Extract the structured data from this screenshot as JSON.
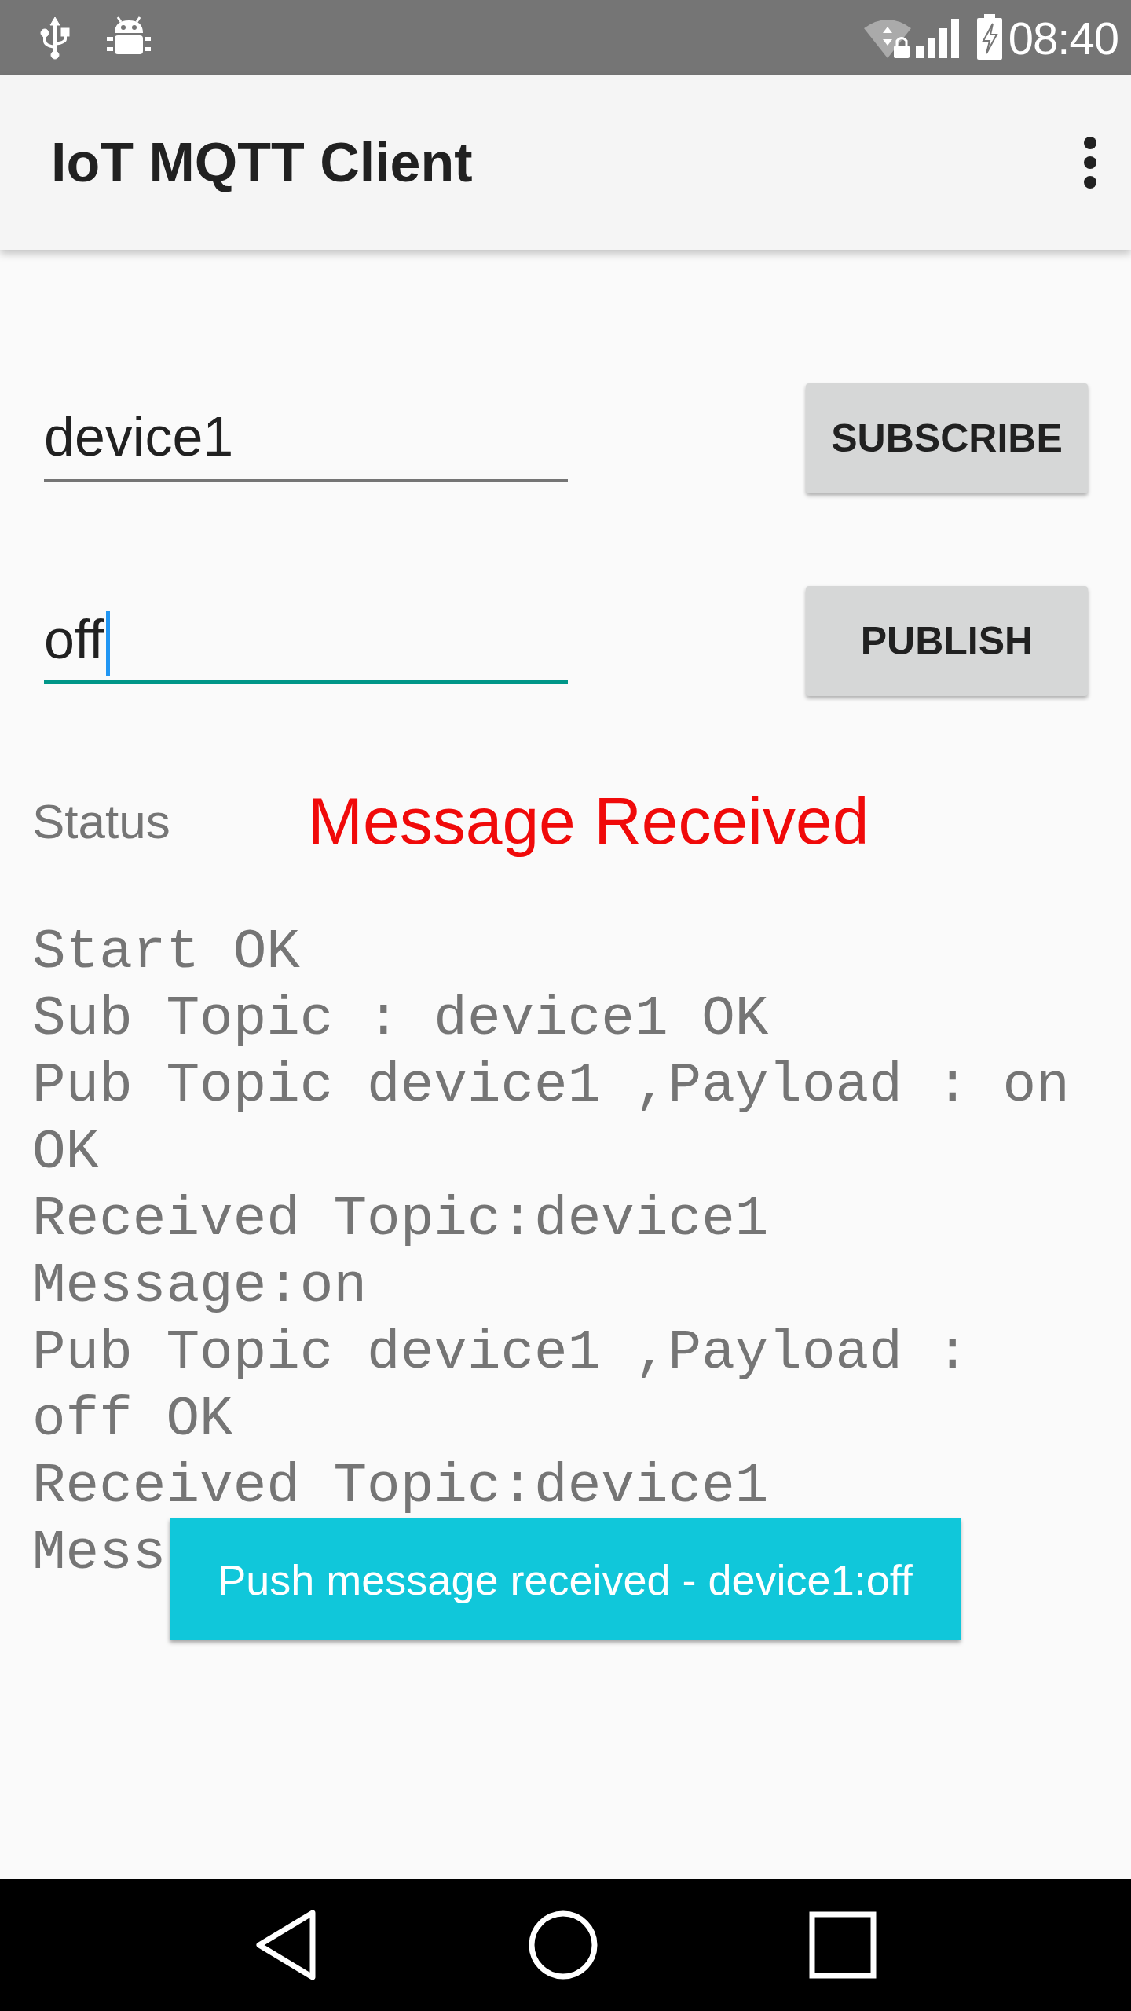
{
  "status_bar": {
    "time": "08:40"
  },
  "app_bar": {
    "title": "IoT MQTT Client"
  },
  "topic_rows": [
    {
      "field": {
        "value": "device1",
        "focused": false
      },
      "button": "SUBSCRIBE"
    },
    {
      "field": {
        "value": "off",
        "focused": true
      },
      "button": "PUBLISH"
    }
  ],
  "status": {
    "label": "Status",
    "message": "Message Received"
  },
  "log": [
    "Start OK",
    "Sub Topic : device1 OK",
    "Pub Topic device1 ,Payload : on",
    "OK",
    "Received Topic:device1",
    "Message:on",
    "Pub Topic device1 ,Payload :",
    "off OK",
    "Received Topic:device1",
    "Mess"
  ],
  "toast": "Push message received - device1:off"
}
